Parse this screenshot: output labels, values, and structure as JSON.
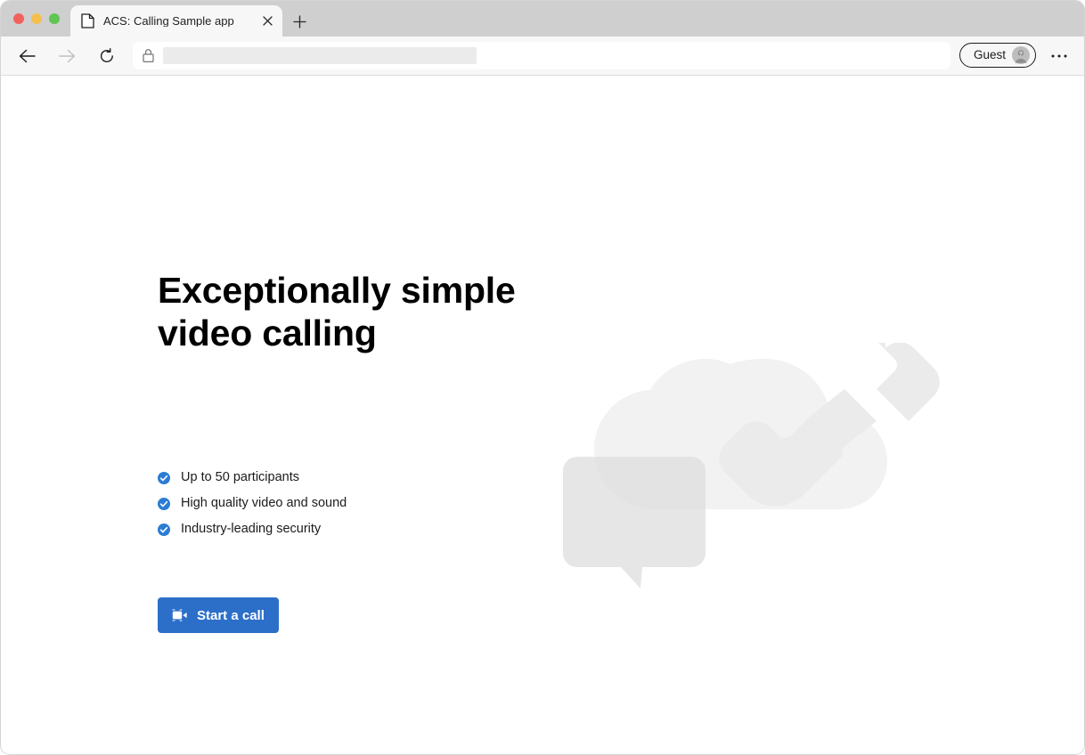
{
  "browser": {
    "window_controls": [
      {
        "name": "close",
        "color": "#f2625d"
      },
      {
        "name": "minimize",
        "color": "#f5bf4f"
      },
      {
        "name": "maximize",
        "color": "#61c554"
      }
    ],
    "tab": {
      "title": "ACS: Calling Sample app",
      "favicon": "page-icon",
      "close_icon": "close-icon"
    },
    "new_tab_icon": "plus-icon",
    "nav": {
      "back_icon": "arrow-left-icon",
      "forward_icon": "arrow-right-icon",
      "reload_icon": "reload-icon"
    },
    "address_bar": {
      "lock_icon": "lock-icon",
      "value": "",
      "placeholder": ""
    },
    "profile": {
      "label": "Guest",
      "avatar_icon": "account-question-icon"
    },
    "more_icon": "ellipsis-icon"
  },
  "page": {
    "headline": "Exceptionally simple\nvideo calling",
    "features": [
      {
        "icon": "check-circle-icon",
        "text": "Up to 50 participants"
      },
      {
        "icon": "check-circle-icon",
        "text": "High quality video and sound"
      },
      {
        "icon": "check-circle-icon",
        "text": "Industry-leading security"
      }
    ],
    "cta": {
      "label": "Start a call",
      "icon": "video-camera-icon"
    },
    "illustration": {
      "name": "cloud-phone-chat-illustration",
      "shapes": [
        "cloud",
        "phone-handset",
        "chat-bubble"
      ]
    }
  },
  "colors": {
    "accent": "#2c6fc9",
    "check": "#2b7cd3",
    "page_background": "#ffffff",
    "toolbar_background": "#f7f7f7",
    "tabstrip_background": "#cfcfcf",
    "illustration_light": "#f2f2f2",
    "illustration_mid": "#e6e6e6"
  }
}
